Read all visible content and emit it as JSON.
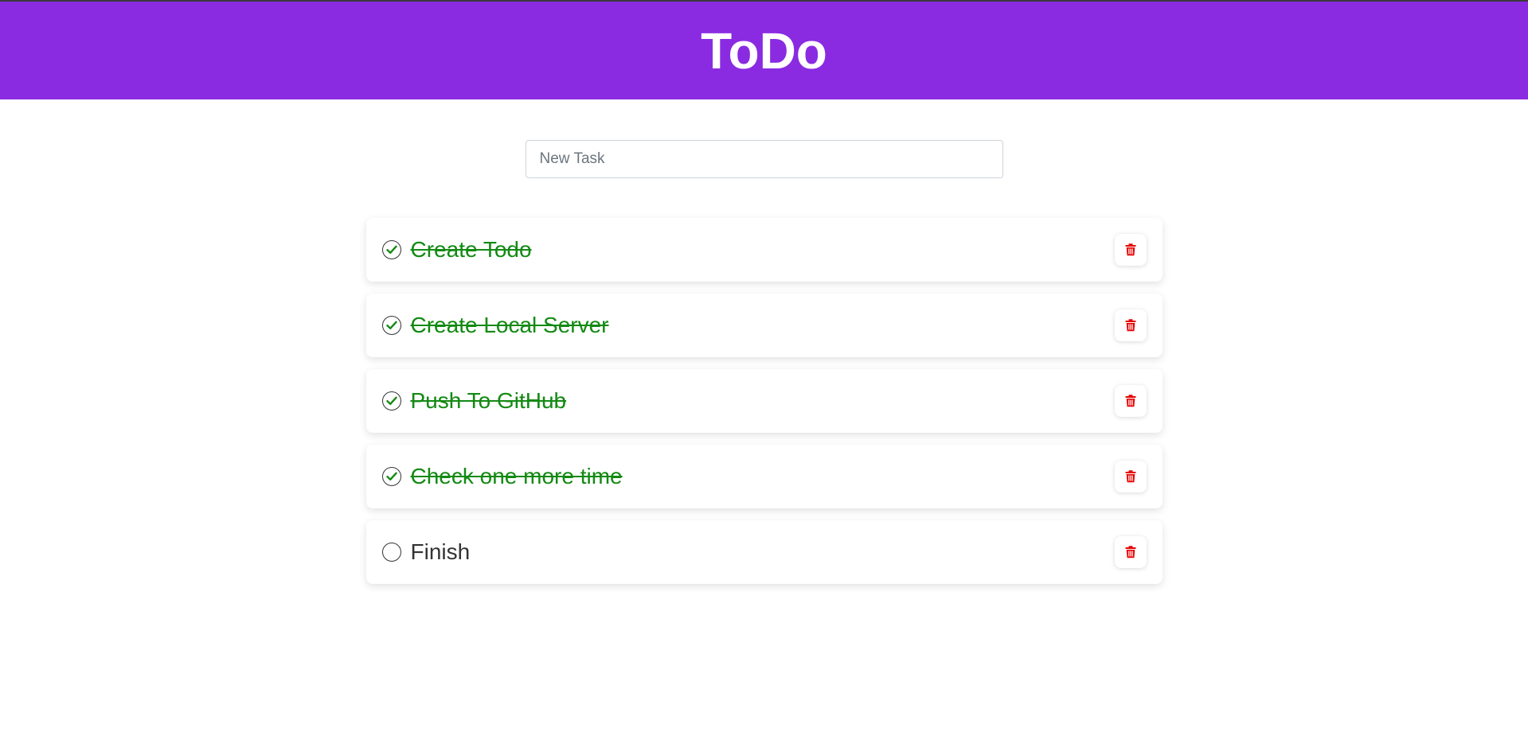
{
  "app": {
    "title": "ToDo",
    "header_color": "#8a2be2"
  },
  "new_task": {
    "placeholder": "New Task",
    "value": ""
  },
  "colors": {
    "done_text": "#138a13",
    "delete_icon": "#e60000"
  },
  "tasks": [
    {
      "text": "Create Todo",
      "done": true
    },
    {
      "text": "Create Local Server",
      "done": true
    },
    {
      "text": "Push To GitHub",
      "done": true
    },
    {
      "text": "Check one more time",
      "done": true
    },
    {
      "text": "Finish",
      "done": false
    }
  ],
  "icons": {
    "check": "check-circle-icon",
    "empty": "circle-icon",
    "delete": "trash-icon"
  }
}
